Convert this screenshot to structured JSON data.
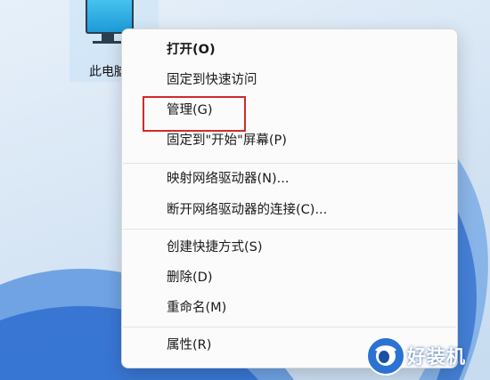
{
  "desktop": {
    "icon_label": "此电脑"
  },
  "context_menu": {
    "items": [
      {
        "label": "打开(O)"
      },
      {
        "label": "固定到快速访问"
      },
      {
        "label": "管理(G)"
      },
      {
        "label": "固定到\"开始\"屏幕(P)"
      },
      {
        "label": "映射网络驱动器(N)..."
      },
      {
        "label": "断开网络驱动器的连接(C)..."
      },
      {
        "label": "创建快捷方式(S)"
      },
      {
        "label": "删除(D)"
      },
      {
        "label": "重命名(M)"
      },
      {
        "label": "属性(R)"
      }
    ],
    "highlight_color": "#d12b2b"
  },
  "watermark": {
    "text": "好装机"
  }
}
